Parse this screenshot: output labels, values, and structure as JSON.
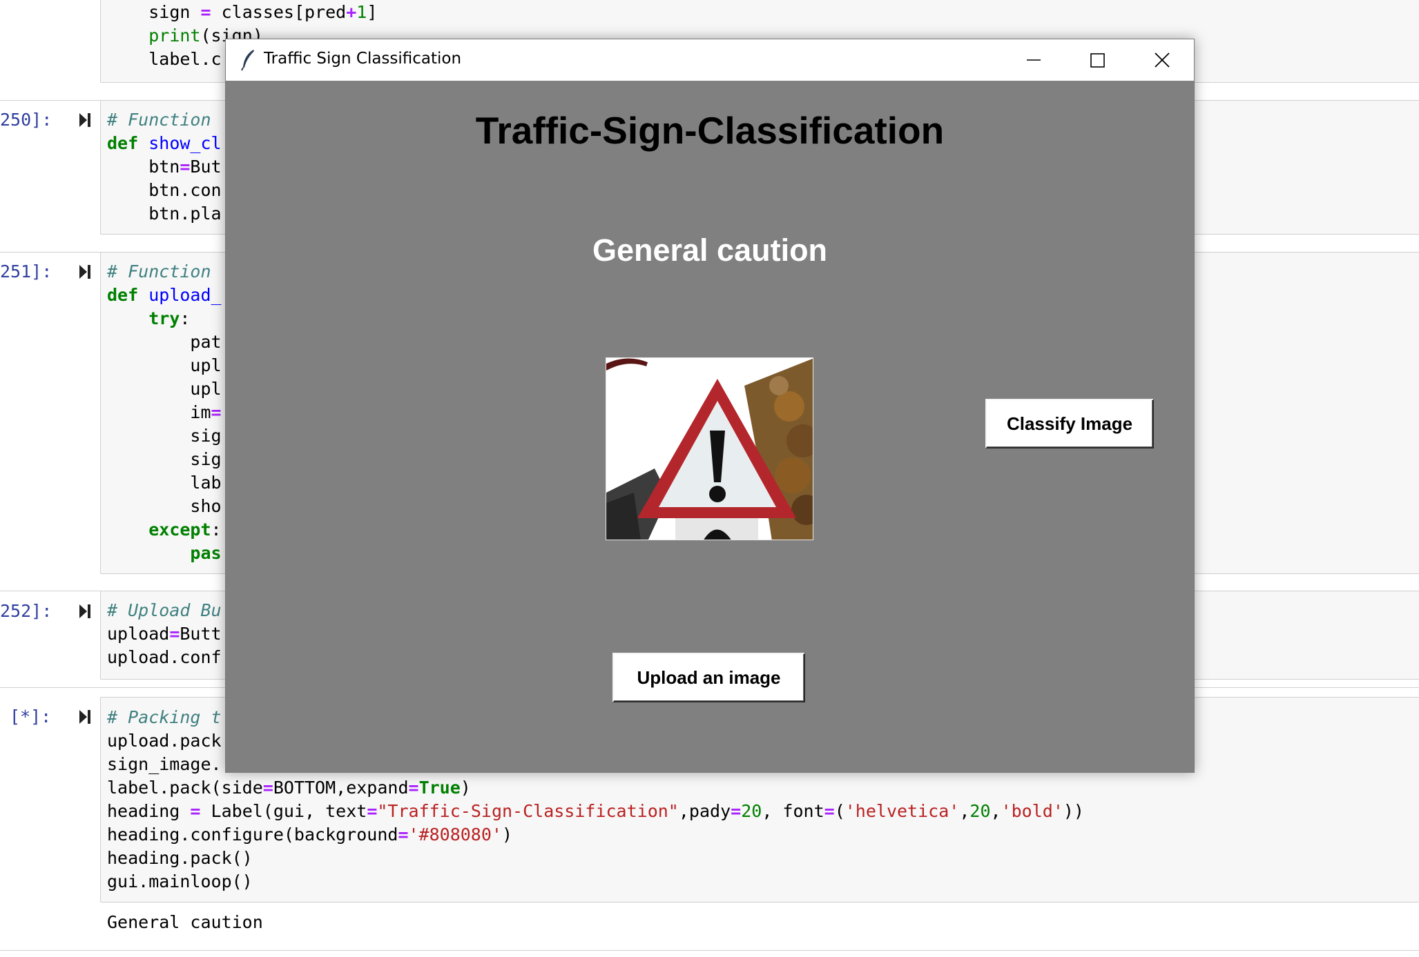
{
  "notebook": {
    "cell_top_lines": [
      {
        "indent": "    ",
        "parts": [
          [
            "",
            "sign "
          ],
          [
            "op",
            "="
          ],
          [
            "",
            " classes[pred"
          ],
          [
            "op",
            "+"
          ],
          [
            "num",
            "1"
          ],
          [
            "",
            "]"
          ]
        ]
      },
      {
        "indent": "    ",
        "parts": [
          [
            "bi",
            "print"
          ],
          [
            "",
            "(sign)"
          ]
        ]
      },
      {
        "indent": "    ",
        "parts": [
          [
            "",
            "label.c"
          ]
        ]
      }
    ],
    "cell_250": {
      "prompt": "250]:",
      "lines": [
        {
          "parts": [
            [
              "cm",
              "# Function "
            ]
          ]
        },
        {
          "parts": [
            [
              "kw",
              "def"
            ],
            [
              "",
              " "
            ],
            [
              "fn",
              "show_cl"
            ]
          ]
        },
        {
          "parts": [
            [
              "",
              "    btn"
            ],
            [
              "op",
              "="
            ],
            [
              "",
              "But"
            ]
          ]
        },
        {
          "parts": [
            [
              "",
              "    btn.con"
            ]
          ]
        },
        {
          "parts": [
            [
              "",
              "    btn.pla"
            ]
          ]
        }
      ]
    },
    "cell_251": {
      "prompt": "251]:",
      "lines": [
        {
          "parts": [
            [
              "cm",
              "# Function "
            ]
          ]
        },
        {
          "parts": [
            [
              "kw",
              "def"
            ],
            [
              "",
              " "
            ],
            [
              "fn",
              "upload_"
            ]
          ]
        },
        {
          "parts": [
            [
              "",
              "    "
            ],
            [
              "kw",
              "try"
            ],
            [
              "",
              ":"
            ]
          ]
        },
        {
          "parts": [
            [
              "",
              "        pat"
            ]
          ]
        },
        {
          "parts": [
            [
              "",
              "        upl"
            ]
          ]
        },
        {
          "parts": [
            [
              "",
              "        upl"
            ]
          ]
        },
        {
          "parts": [
            [
              "",
              "        im"
            ],
            [
              "op",
              "="
            ]
          ]
        },
        {
          "parts": [
            [
              "",
              "        sig"
            ]
          ]
        },
        {
          "parts": [
            [
              "",
              "        sig"
            ]
          ]
        },
        {
          "parts": [
            [
              "",
              "        lab"
            ]
          ]
        },
        {
          "parts": [
            [
              "",
              "        sho"
            ]
          ]
        },
        {
          "parts": [
            [
              "",
              "    "
            ],
            [
              "kw",
              "except"
            ],
            [
              "",
              ":"
            ]
          ]
        },
        {
          "parts": [
            [
              "",
              "        "
            ],
            [
              "kw",
              "pas"
            ]
          ]
        }
      ]
    },
    "cell_252": {
      "prompt": "252]:",
      "lines": [
        {
          "parts": [
            [
              "cm",
              "# Upload Bu"
            ]
          ]
        },
        {
          "parts": [
            [
              "",
              "upload"
            ],
            [
              "op",
              "="
            ],
            [
              "",
              "Butt"
            ]
          ]
        },
        {
          "parts": [
            [
              "",
              "upload.conf"
            ]
          ]
        }
      ]
    },
    "cell_run": {
      "prompt": "[*]:",
      "lines": [
        {
          "parts": [
            [
              "cm",
              "# Packing t"
            ]
          ]
        },
        {
          "parts": [
            [
              "",
              "upload.pack"
            ]
          ]
        },
        {
          "parts": [
            [
              "",
              "sign_image."
            ]
          ]
        },
        {
          "parts": [
            [
              "",
              "label.pack(side"
            ],
            [
              "op",
              "="
            ],
            [
              "",
              "BOTTOM,expand"
            ],
            [
              "op",
              "="
            ],
            [
              "kw",
              "True"
            ],
            [
              "",
              ")"
            ]
          ]
        },
        {
          "parts": [
            [
              "",
              "heading "
            ],
            [
              "op",
              "="
            ],
            [
              "",
              " Label(gui, text"
            ],
            [
              "op",
              "="
            ],
            [
              "str",
              "\"Traffic-Sign-Classification\""
            ],
            [
              "",
              ",pady"
            ],
            [
              "op",
              "="
            ],
            [
              "num",
              "20"
            ],
            [
              "",
              ", font"
            ],
            [
              "op",
              "="
            ],
            [
              "",
              "("
            ],
            [
              "str",
              "'helvetica'"
            ],
            [
              "",
              ","
            ],
            [
              "num",
              "20"
            ],
            [
              "",
              ","
            ],
            [
              "str",
              "'bold'"
            ],
            [
              "",
              "))"
            ]
          ]
        },
        {
          "parts": [
            [
              "",
              "heading.configure(background"
            ],
            [
              "op",
              "="
            ],
            [
              "str",
              "'#808080'"
            ],
            [
              "",
              ")"
            ]
          ]
        },
        {
          "parts": [
            [
              "",
              "heading.pack()"
            ]
          ]
        },
        {
          "parts": [
            [
              "",
              "gui.mainloop()"
            ]
          ]
        }
      ],
      "output": "General caution"
    }
  },
  "window": {
    "title": "Traffic Sign Classification",
    "heading": "Traffic-Sign-Classification",
    "result_label": "General caution",
    "classify_button": "Classify Image",
    "upload_button": "Upload an image",
    "background_color": "#808080"
  }
}
